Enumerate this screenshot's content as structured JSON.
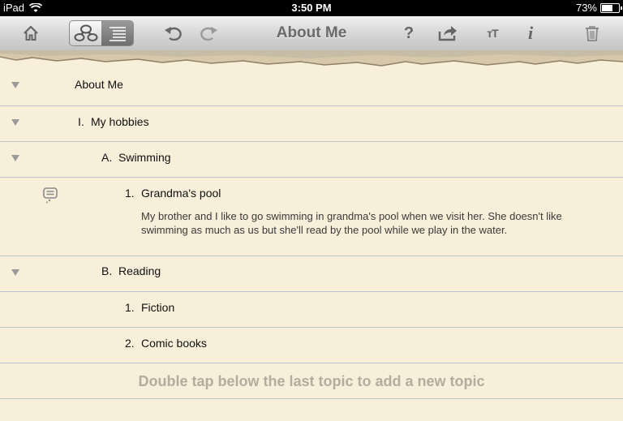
{
  "status": {
    "carrier": "iPad",
    "time": "3:50 PM",
    "battery": "73%",
    "battery_level": 0.73
  },
  "toolbar": {
    "title": "About Me",
    "help_label": "?",
    "text_size_label": "тT",
    "info_label": "i"
  },
  "outline": {
    "root": {
      "title": "About Me"
    },
    "hobbies": {
      "number": "I.",
      "title": "My hobbies"
    },
    "swimming": {
      "number": "A.",
      "title": "Swimming"
    },
    "pool": {
      "number": "1.",
      "title": "Grandma's pool",
      "note": "My brother and I like to go swimming in grandma's pool when we visit her. She doesn't like swimming as much as us but she'll read by the pool while we play in the water."
    },
    "reading": {
      "number": "B.",
      "title": "Reading"
    },
    "fiction": {
      "number": "1.",
      "title": "Fiction"
    },
    "comics": {
      "number": "2.",
      "title": "Comic books"
    }
  },
  "hint": "Double tap below the last topic to add a new topic",
  "colors": {
    "paper": "#f7efd9",
    "rule": "#b8c4cc",
    "toolbar_icon": "#666666"
  }
}
